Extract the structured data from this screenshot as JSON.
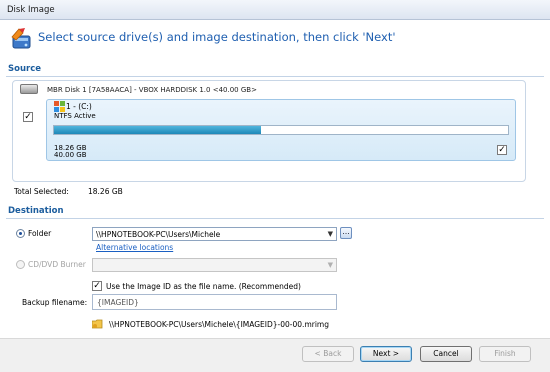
{
  "window": {
    "title": "Disk Image"
  },
  "header": {
    "heading": "Select source drive(s) and image destination, then click 'Next'"
  },
  "source": {
    "section_title": "Source",
    "disk_label": "MBR Disk 1 [7A58AACA] - VBOX HARDDISK 1.0  <40.00 GB>",
    "disk_checked": "✓",
    "partition": {
      "name": "1 - (C:)",
      "type": "NTFS Active",
      "used_text": "18.26 GB",
      "total_text": "40.00 GB",
      "used_fraction": 0.4565,
      "checked": "✓"
    },
    "total_selected_label": "Total Selected:",
    "total_selected_value": "18.26 GB"
  },
  "destination": {
    "section_title": "Destination",
    "folder_label": "Folder",
    "folder_value": "\\\\HPNOTEBOOK-PC\\Users\\Michele",
    "browse_label": "...",
    "alt_locations_link": "Alternative locations",
    "cd_label": "CD/DVD Burner",
    "cd_value": "",
    "use_image_id_checked": "✓",
    "use_image_id_label": "Use the Image ID as the file name.  (Recommended)",
    "backup_filename_label": "Backup filename:",
    "backup_filename_value": "{IMAGEID}",
    "resolved_path": "\\\\HPNOTEBOOK-PC\\Users\\Michele\\{IMAGEID}-00-00.mrimg"
  },
  "footer": {
    "back_label": "< Back",
    "next_label": "Next >",
    "cancel_label": "Cancel",
    "finish_label": "Finish"
  },
  "colors": {
    "accent": "#1f5fb0",
    "section_title": "#1c5d9e",
    "progress_fill": "#1e88b8",
    "link": "#1a5fc2"
  },
  "icons": {
    "wizard": "disk-image-wizard-icon",
    "disk": "hard-disk-icon",
    "partition": "windows-partition-icon",
    "browse": "ellipsis-icon",
    "path": "folder-path-icon"
  }
}
